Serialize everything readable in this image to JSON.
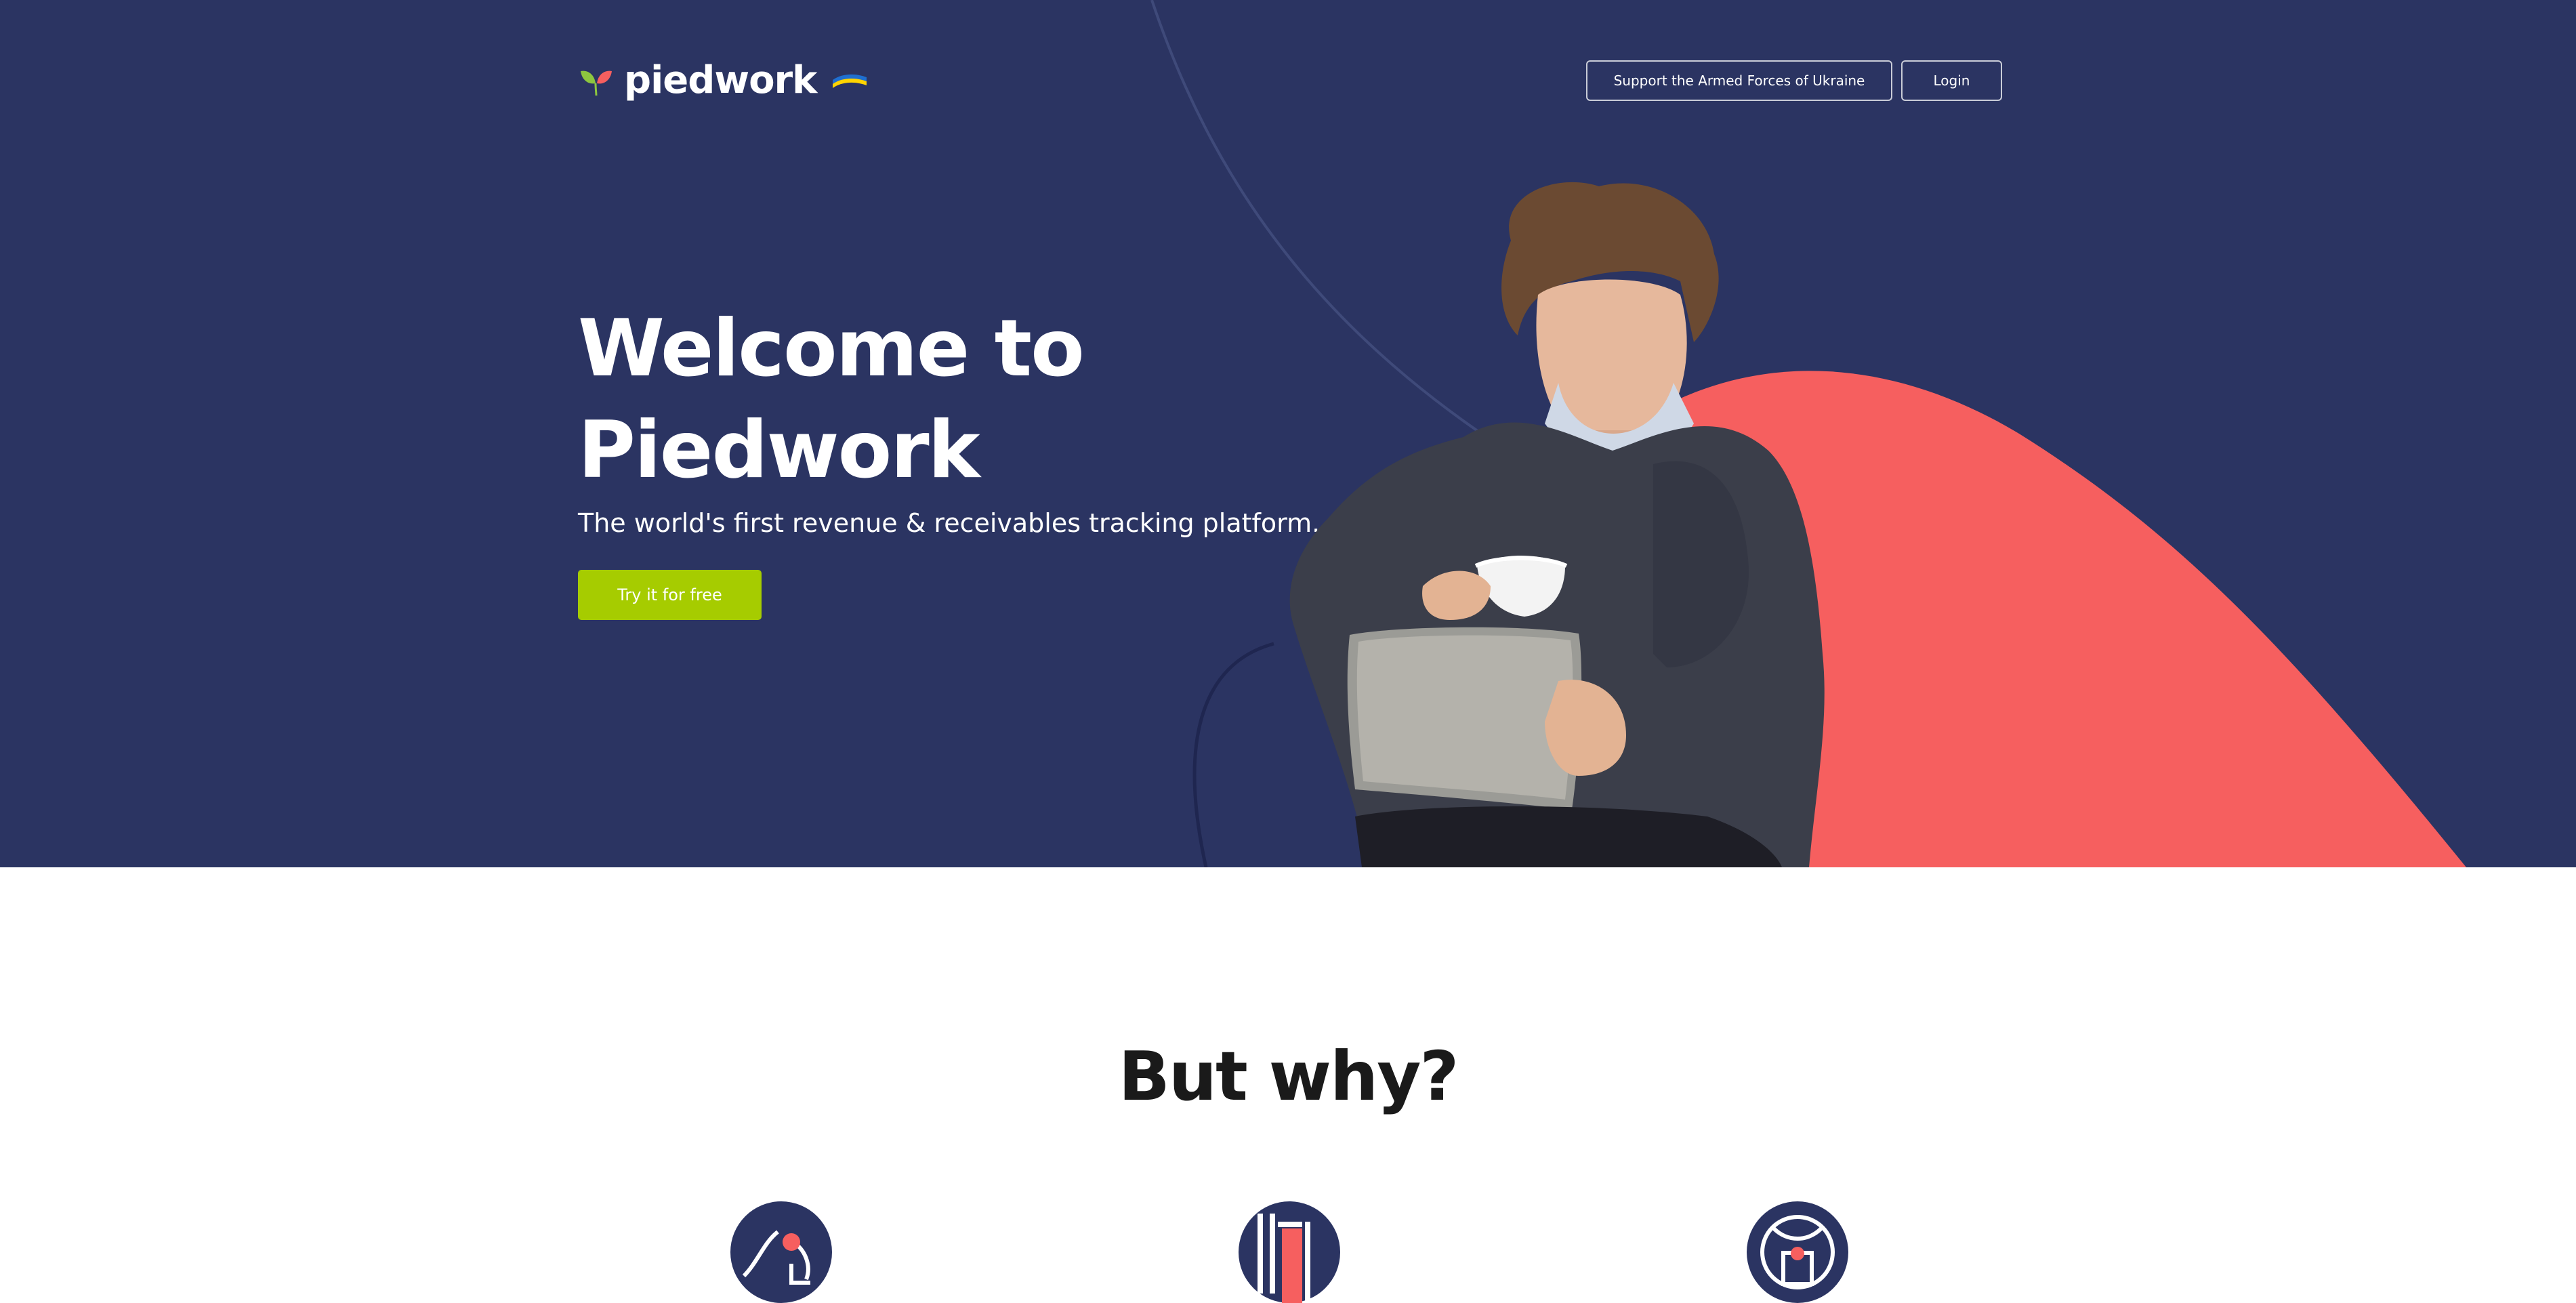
{
  "header": {
    "logo_text": "piedwork",
    "logo_icon": "leaf-logo-icon",
    "flag_icon": "ukraine-flag-icon",
    "support_label": "Support the Armed Forces of Ukraine",
    "login_label": "Login"
  },
  "hero": {
    "title_line1": "Welcome to",
    "title_line2": "Piedwork",
    "subtitle": "The world's first revenue & receivables tracking platform.",
    "cta_label": "Try it for free",
    "photo_alt": "person-with-tablet-and-coffee"
  },
  "why": {
    "title": "But why?",
    "features": [
      {
        "icon": "clock-arc-icon"
      },
      {
        "icon": "bar-chart-icon"
      },
      {
        "icon": "target-person-icon"
      }
    ]
  },
  "colors": {
    "hero_bg": "#2b3462",
    "accent_coral": "#f65f5f",
    "cta_green": "#a6cc00",
    "logo_green": "#8dc63f",
    "logo_red": "#f65f5f",
    "flag_blue": "#1f6fd0",
    "flag_yellow": "#ffd400"
  }
}
